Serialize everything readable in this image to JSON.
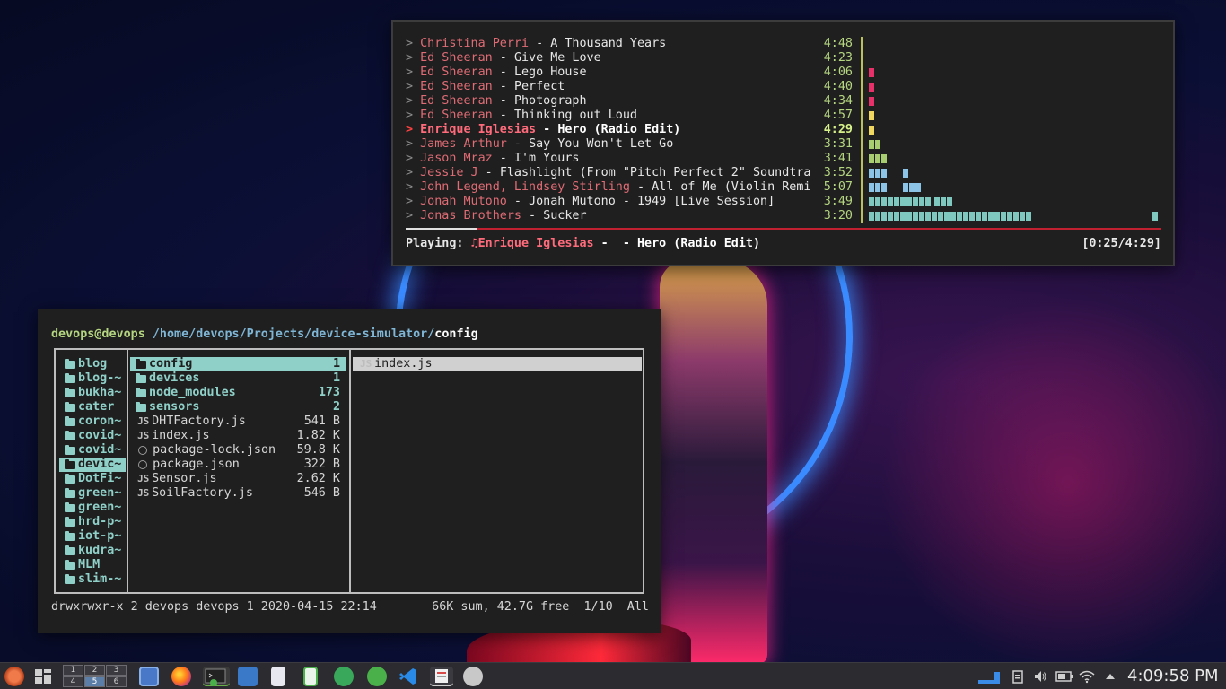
{
  "player": {
    "tracks": [
      {
        "artist": "Christina Perri",
        "title": "A Thousand Years",
        "duration": "4:48"
      },
      {
        "artist": "Ed Sheeran",
        "title": "Give Me Love",
        "duration": "4:23"
      },
      {
        "artist": "Ed Sheeran",
        "title": "Lego House",
        "duration": "4:06"
      },
      {
        "artist": "Ed Sheeran",
        "title": "Perfect",
        "duration": "4:40"
      },
      {
        "artist": "Ed Sheeran",
        "title": "Photograph",
        "duration": "4:34"
      },
      {
        "artist": "Ed Sheeran",
        "title": "Thinking out Loud",
        "duration": "4:57"
      },
      {
        "artist": "Enrique Iglesias",
        "title": "Hero (Radio Edit)",
        "duration": "4:29"
      },
      {
        "artist": "James Arthur",
        "title": "Say You Won't Let Go",
        "duration": "3:31"
      },
      {
        "artist": "Jason Mraz",
        "title": "I'm Yours",
        "duration": "3:41"
      },
      {
        "artist": "Jessie J",
        "title": "Flashlight (From \"Pitch Perfect 2\" Soundtra",
        "duration": "3:52"
      },
      {
        "artist": "John Legend, Lindsey Stirling",
        "title": "All of Me (Violin Remi",
        "duration": "5:07"
      },
      {
        "artist": "Jonah Mutono",
        "title": "Jonah Mutono - 1949 [Live Session]",
        "duration": "3:49"
      },
      {
        "artist": "Jonas Brothers",
        "title": "Sucker",
        "duration": "3:20"
      }
    ],
    "current_index": 6,
    "caret": ">",
    "separator": " - ",
    "now_playing": {
      "label": "Playing:",
      "artist": "Enrique Iglesias",
      "separator": " -  - ",
      "title": "Hero (Radio Edit)",
      "time": "[0:25/4:29]"
    },
    "visualizer_colors": {
      "low": "#e8306a",
      "mid": "#f0d860",
      "high": "#a8cc70",
      "cool": "#8cc4e8",
      "teal": "#7ec8c0"
    }
  },
  "file_manager": {
    "user_host": "devops@devops",
    "path_prefix": " /home/devops/Projects/device-simulator/",
    "path_leaf": "config",
    "parent_dirs": [
      "blog",
      "blog-~",
      "bukha~",
      "cater",
      "coron~",
      "covid~",
      "covid~",
      "devic~",
      "DotFi~",
      "green~",
      "green~",
      "hrd-p~",
      "iot-p~",
      "kudra~",
      "MLM",
      "slim-~"
    ],
    "parent_selected": 7,
    "entries": [
      {
        "name": "config",
        "type": "dir",
        "size": "1"
      },
      {
        "name": "devices",
        "type": "dir",
        "size": "1"
      },
      {
        "name": "node_modules",
        "type": "dir",
        "size": "173"
      },
      {
        "name": "sensors",
        "type": "dir",
        "size": "2"
      },
      {
        "name": "DHTFactory.js",
        "type": "js",
        "size": "541 B"
      },
      {
        "name": "index.js",
        "type": "js",
        "size": "1.82 K"
      },
      {
        "name": "package-lock.json",
        "type": "json",
        "size": "59.8 K"
      },
      {
        "name": "package.json",
        "type": "json",
        "size": "322 B"
      },
      {
        "name": "Sensor.js",
        "type": "js",
        "size": "2.62 K"
      },
      {
        "name": "SoilFactory.js",
        "type": "js",
        "size": "546 B"
      }
    ],
    "entries_selected": 0,
    "preview": [
      {
        "name": "index.js",
        "type": "js"
      }
    ],
    "js_icon": "JS",
    "status_left": "drwxrwxr-x 2 devops devops 1 2020-04-15 22:14",
    "status_right": "66K sum, 42.7G free  1/10  All"
  },
  "taskbar": {
    "pager": [
      "1",
      "2",
      "3",
      "4",
      "5",
      "6"
    ],
    "pager_active": 4,
    "launchers": [
      "app-menu-icon",
      "overview-icon",
      "pager",
      "window-icon",
      "firefox-icon",
      "terminal-icon",
      "store-icon",
      "document-icon",
      "spreadsheet-icon",
      "android-studio-icon",
      "qt-creator-icon",
      "vscode-icon",
      "reader-icon",
      "avatar-icon"
    ],
    "tray": [
      "network-graph-icon",
      "clipboard-icon",
      "volume-icon",
      "battery-icon",
      "wifi-icon",
      "expand-tray-icon"
    ],
    "clock": "4:09:58 PM"
  }
}
